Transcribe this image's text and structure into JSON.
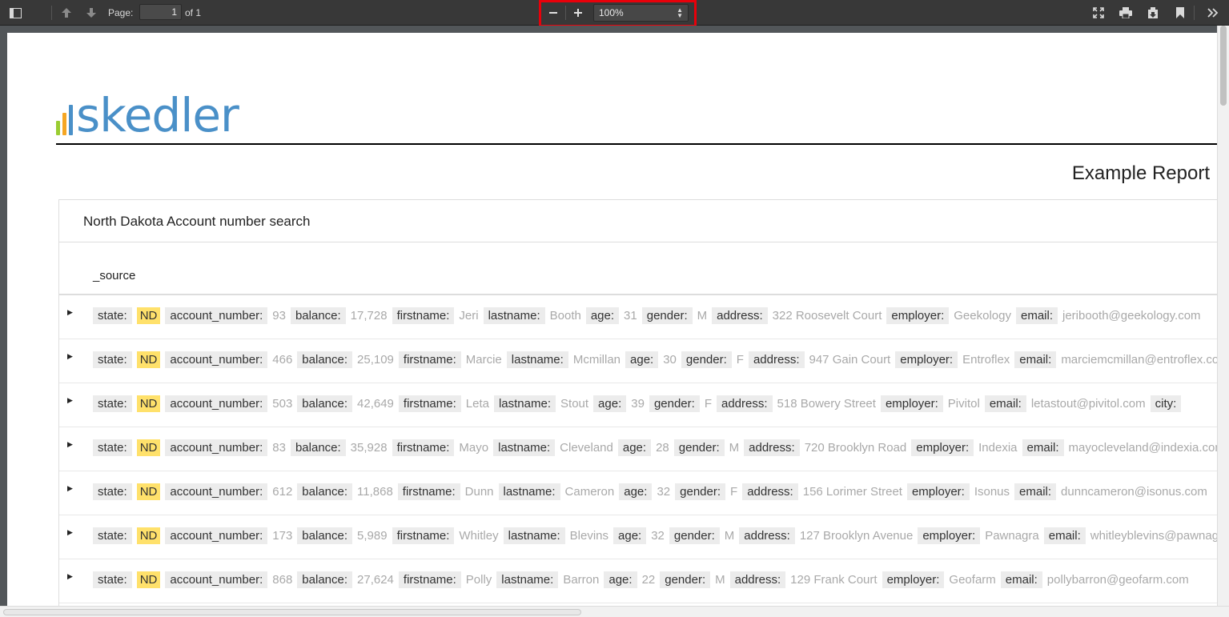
{
  "toolbar": {
    "page_label": "Page:",
    "page_value": "1",
    "page_of": "of 1",
    "zoom_value": "100%",
    "icons": [
      "sidebar-toggle-icon",
      "previous-page-icon",
      "next-page-icon",
      "zoom-out-icon",
      "zoom-in-icon",
      "presentation-mode-icon",
      "print-icon",
      "download-icon",
      "bookmark-icon",
      "tools-icon"
    ]
  },
  "report": {
    "logo_text": "skedler",
    "logo_colors": [
      "#9acd32",
      "#f5a623",
      "#4a90c8"
    ],
    "title": "Example Report",
    "panel_title": "North Dakota Account number search",
    "column_header": "_source"
  },
  "rows": [
    {
      "state": "ND",
      "account_number": "93",
      "balance": "17,728",
      "firstname": "Jeri",
      "lastname": "Booth",
      "age": "31",
      "gender": "M",
      "address": "322 Roosevelt Court",
      "employer": "Geekology",
      "email": "jeribooth@geekology.com"
    },
    {
      "state": "ND",
      "account_number": "466",
      "balance": "25,109",
      "firstname": "Marcie",
      "lastname": "Mcmillan",
      "age": "30",
      "gender": "F",
      "address": "947 Gain Court",
      "employer": "Entroflex",
      "email": "marciemcmillan@entroflex.com"
    },
    {
      "state": "ND",
      "account_number": "503",
      "balance": "42,649",
      "firstname": "Leta",
      "lastname": "Stout",
      "age": "39",
      "gender": "F",
      "address": "518 Bowery Street",
      "employer": "Pivitol",
      "email": "letastout@pivitol.com",
      "extra_key": "city:"
    },
    {
      "state": "ND",
      "account_number": "83",
      "balance": "35,928",
      "firstname": "Mayo",
      "lastname": "Cleveland",
      "age": "28",
      "gender": "M",
      "address": "720 Brooklyn Road",
      "employer": "Indexia",
      "email": "mayocleveland@indexia.com"
    },
    {
      "state": "ND",
      "account_number": "612",
      "balance": "11,868",
      "firstname": "Dunn",
      "lastname": "Cameron",
      "age": "32",
      "gender": "F",
      "address": "156 Lorimer Street",
      "employer": "Isonus",
      "email": "dunncameron@isonus.com"
    },
    {
      "state": "ND",
      "account_number": "173",
      "balance": "5,989",
      "firstname": "Whitley",
      "lastname": "Blevins",
      "age": "32",
      "gender": "M",
      "address": "127 Brooklyn Avenue",
      "employer": "Pawnagra",
      "email": "whitleyblevins@pawnagra.com"
    },
    {
      "state": "ND",
      "account_number": "868",
      "balance": "27,624",
      "firstname": "Polly",
      "lastname": "Barron",
      "age": "22",
      "gender": "M",
      "address": "129 Frank Court",
      "employer": "Geofarm",
      "email": "pollybarron@geofarm.com"
    }
  ],
  "field_labels": {
    "state": "state:",
    "account_number": "account_number:",
    "balance": "balance:",
    "firstname": "firstname:",
    "lastname": "lastname:",
    "age": "age:",
    "gender": "gender:",
    "address": "address:",
    "employer": "employer:",
    "email": "email:"
  }
}
